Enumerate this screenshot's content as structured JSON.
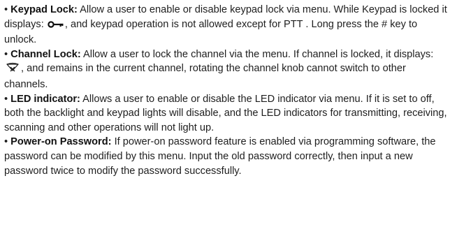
{
  "items": [
    {
      "bullet": "•",
      "term": "Keypad Lock:",
      "text_before_icon": " Allow a user to enable or disable keypad lock via menu. While Keypad is locked it displays: ",
      "icon": "key-icon",
      "text_after_icon": ", and keypad operation is not allowed except for PTT . Long press the # key to unlock."
    },
    {
      "bullet": "•",
      "term": "Channel Lock:",
      "text_before_icon": " Allow a user to lock the channel via the menu. If channel is locked, it displays: ",
      "icon": "channel-lock-icon",
      "text_after_icon": ", and remains in the current channel, rotating the channel knob cannot switch to other channels."
    },
    {
      "bullet": "•",
      "term": "LED indicator:",
      "text": " Allows a user to enable or disable the LED indicator via menu. If it is set to off, both the backlight and keypad lights will disable, and the LED indicators for transmitting, receiving, scanning and other operations will not light up."
    },
    {
      "bullet": "•",
      "term": "Power-on Password:",
      "text": " If power-on password feature is enabled via programming software, the password can be modified by this menu. Input the old password correctly, then input a new password twice to modify the password successfully."
    }
  ]
}
